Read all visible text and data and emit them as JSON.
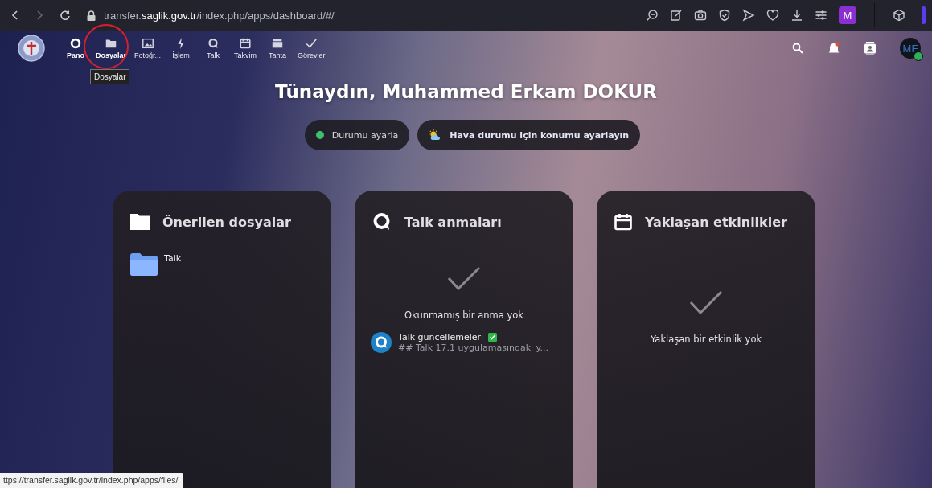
{
  "browser": {
    "url": "transfer.**saglik.gov.tr**/index.php/apps/dashboard/#/",
    "profile": "M"
  },
  "header": {
    "apps": [
      {
        "label": "Pano",
        "selected": true,
        "hovered": false
      },
      {
        "label": "Dosyalar",
        "selected": false,
        "hovered": true
      },
      {
        "label": "Fotoğr...",
        "selected": false,
        "hovered": false
      },
      {
        "label": "İşlem",
        "selected": false,
        "hovered": false
      },
      {
        "label": "Talk",
        "selected": false,
        "hovered": false
      },
      {
        "label": "Takvim",
        "selected": false,
        "hovered": false
      },
      {
        "label": "Tahta",
        "selected": false,
        "hovered": false
      },
      {
        "label": "Görevler",
        "selected": false,
        "hovered": false
      }
    ],
    "tooltip": "Dosyalar",
    "unread_notifications": true,
    "avatar": {
      "initials": "MF",
      "online": true
    }
  },
  "greeting": "Tünaydın, Muhammed Erkam DOKUR",
  "status_buttons": [
    {
      "label": "Durumu ayarla",
      "kind": "status"
    },
    {
      "label": "Hava durumu için konumu ayarlayın",
      "kind": "weather"
    }
  ],
  "cards": [
    {
      "title": "Önerilen dosyalar",
      "kind": "files",
      "items": [
        {
          "name": "Talk"
        }
      ]
    },
    {
      "title": "Talk anmaları",
      "kind": "talk",
      "empty_text": "Okunmamış bir anma yok",
      "items": [
        {
          "title": "Talk güncellemeleri",
          "subtitle": "## Talk 17.1 uygulamasındaki y..."
        }
      ]
    },
    {
      "title": "Yaklaşan etkinlikler",
      "kind": "calendar",
      "empty_text": "Yaklaşan bir etkinlik yok"
    }
  ],
  "status_link": "ttps://transfer.saglik.gov.tr/index.php/apps/files/"
}
